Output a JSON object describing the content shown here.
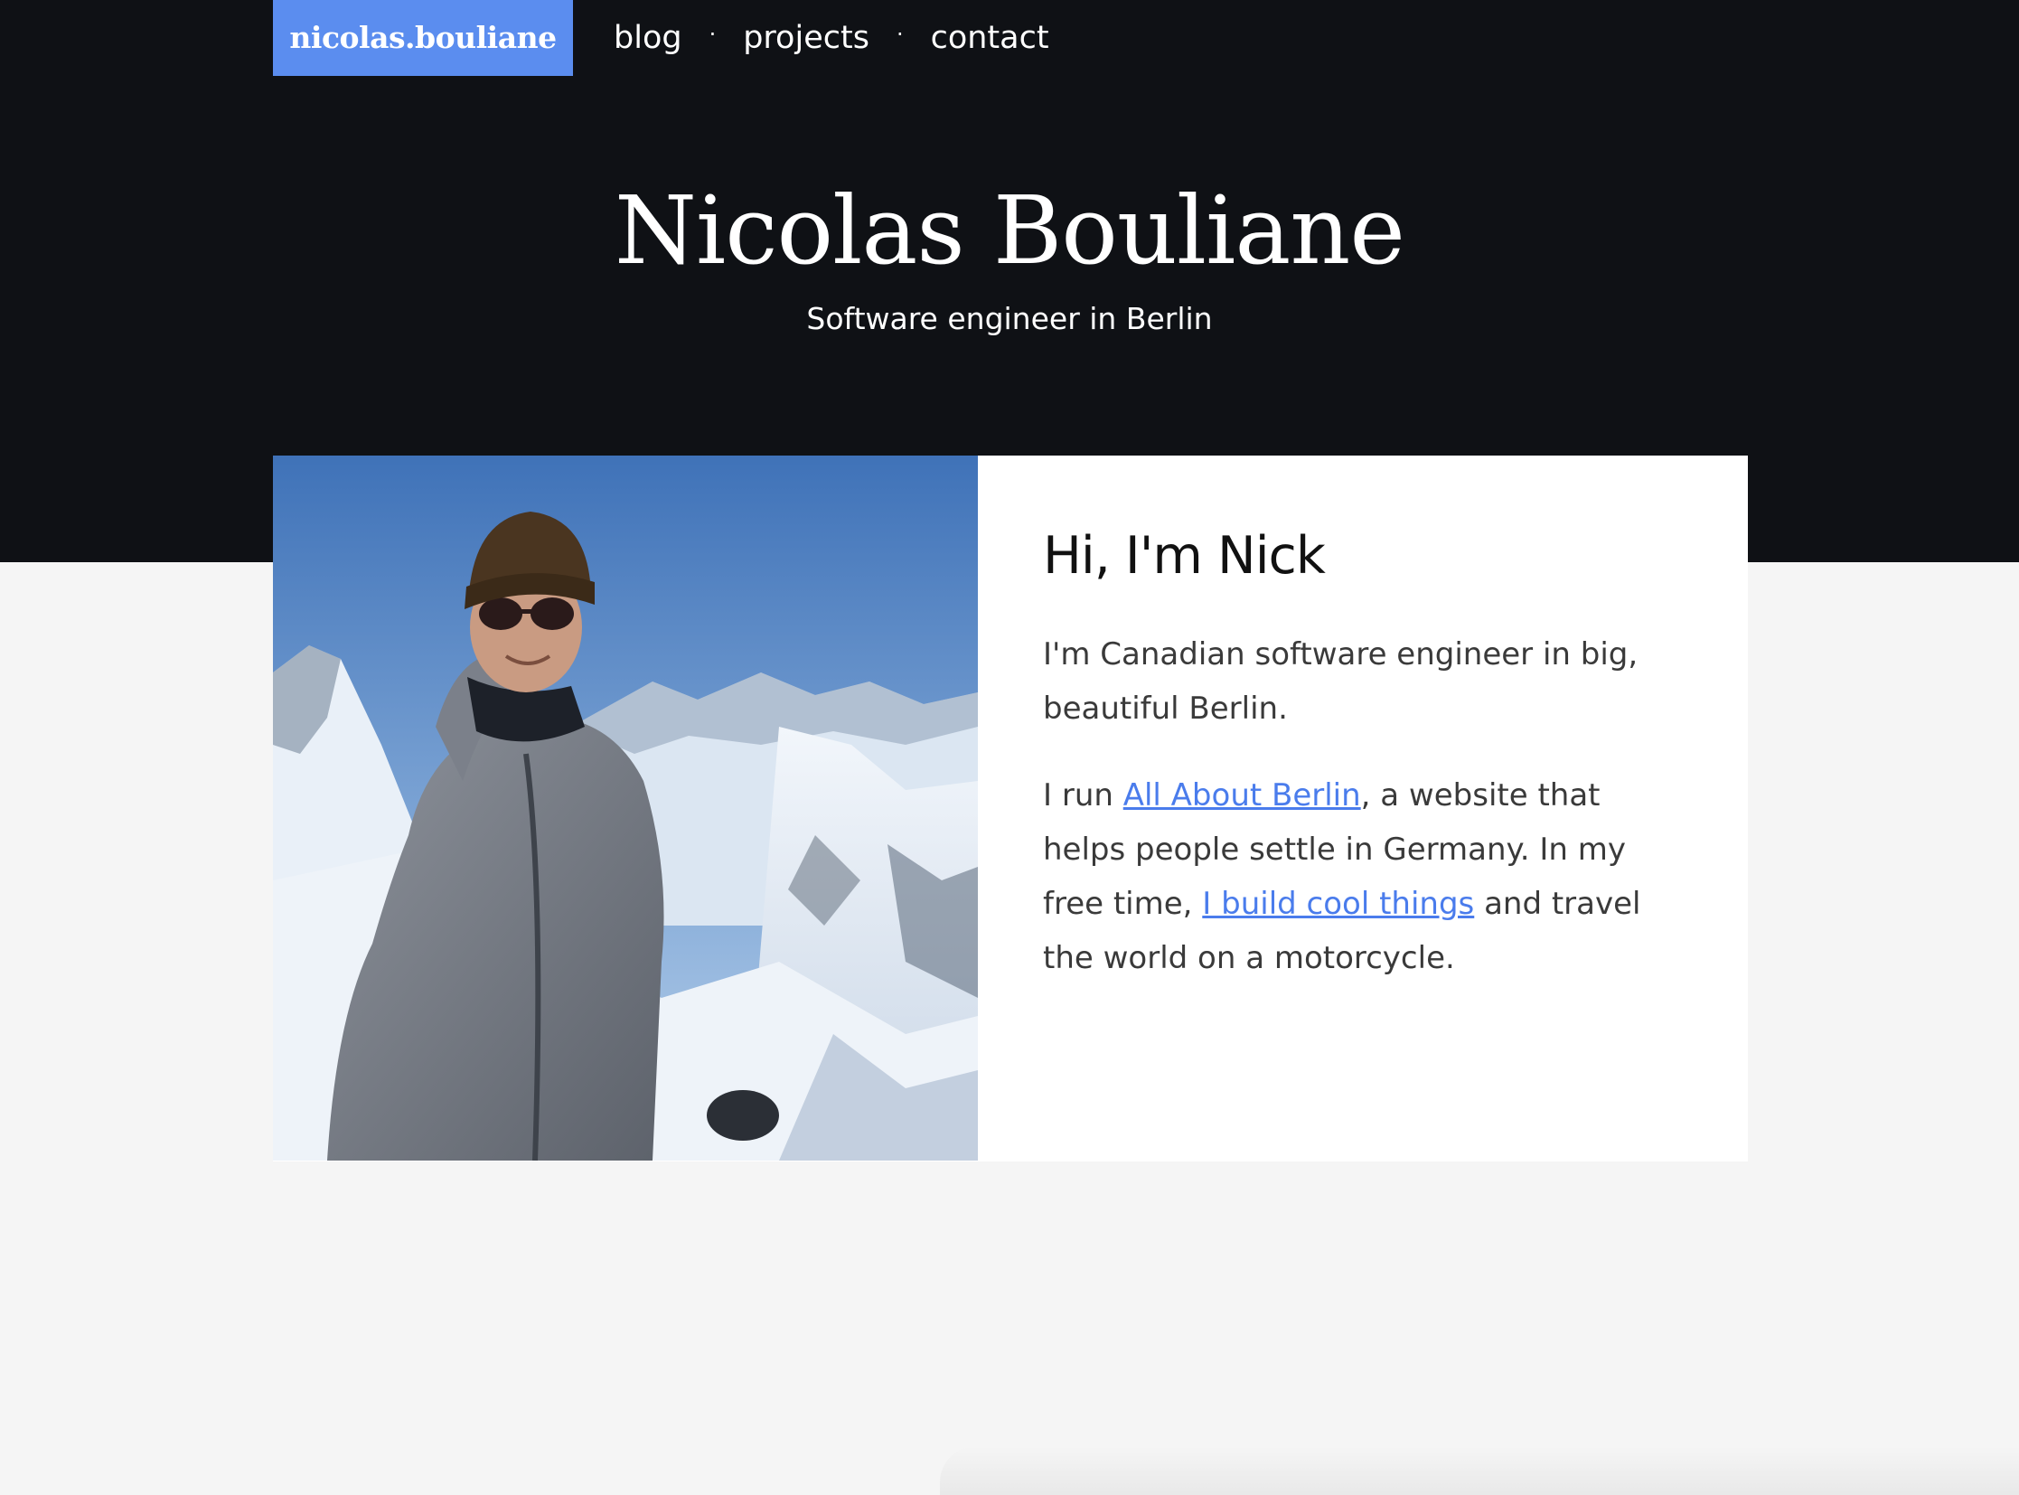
{
  "header": {
    "brand": "nicolas.bouliane",
    "nav": [
      {
        "label": "blog"
      },
      {
        "label": "projects"
      },
      {
        "label": "contact"
      }
    ],
    "separator": "·",
    "title": "Nicolas Bouliane",
    "subtitle": "Software engineer in Berlin"
  },
  "profile": {
    "heading": "Hi, I'm Nick",
    "para1": "I'm Canadian software engineer in big, beautiful Berlin.",
    "para2_prefix": "I run ",
    "para2_link1": "All About Berlin",
    "para2_mid": ", a website that helps people settle in Germany. In my free time, ",
    "para2_link2": "I build cool things",
    "para2_suffix": " and travel the world on a motorcycle."
  },
  "colors": {
    "hero_background": "#0f1115",
    "brand_background": "#5b8def",
    "link": "#4a7cec",
    "page_background": "#f5f5f5"
  }
}
